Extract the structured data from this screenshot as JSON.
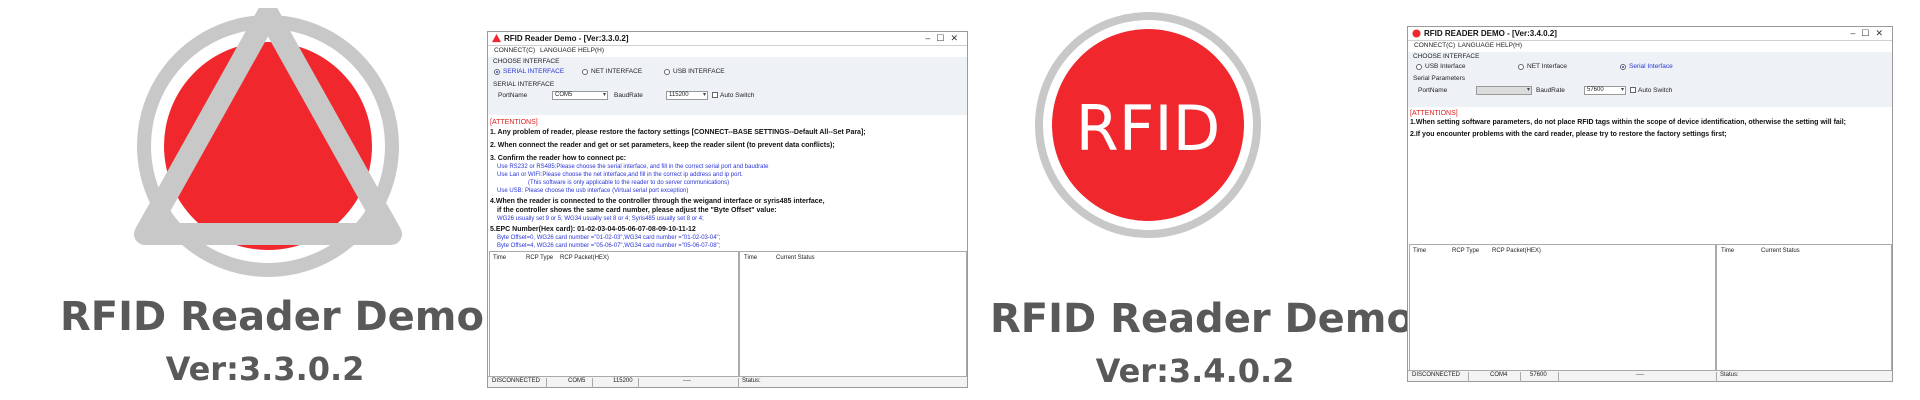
{
  "left_logo": {
    "title": "RFID Reader Demo",
    "version": "Ver:3.3.0.2",
    "colors": {
      "ring": "#c8c8c8",
      "circle": "#f0282d"
    }
  },
  "right_logo": {
    "title": "RFID Reader Demo",
    "version": "Ver:3.4.0.2",
    "circle_text": "RFID",
    "colors": {
      "ring": "#c8c8c8",
      "circle": "#f0282d"
    }
  },
  "win1": {
    "title": "RFID Reader Demo - [Ver:3.3.0.2]",
    "menu": [
      "CONNECT(C)",
      "LANGUAGE",
      "HELP(H)"
    ],
    "choose_interface": "CHOOSE INTERFACE",
    "interfaces": [
      "SERIAL INTERFACE",
      "NET INTERFACE",
      "USB INTERFACE"
    ],
    "selected_interface": "SERIAL INTERFACE",
    "serial_interface": "SERIAL INTERFACE",
    "port_label": "PortName",
    "port_value": "COM5",
    "baud_label": "BaudRate",
    "baud_value": "115200",
    "auto_switch": "Auto Switch",
    "attentions": "[ATTENTIONS]",
    "lines": [
      "1. Any problem of reader, please restore the factory settings [CONNECT--BASE SETTINGS--Default All--Set Para];",
      "2. When connect the reader and get or set parameters, keep the reader silent (to prevent data conflicts);",
      "3. Confirm the reader how to connect pc:",
      "Use RS232 or RS485:Please choose the serial interface, and fill in the correct serial port and baudrate",
      "Use Lan or WIFI:Please choose the net interface,and fill in the correct ip address and ip port.",
      "(This software is only applicable to the reader to do server communications)",
      "Use USB: Please choose the usb interface (Virtual serial port exception)",
      "4.When the reader is connected to the controller through the weigand interface or syris485 interface,",
      "if the controller shows the same card number, please adjust the \"Byte Offset\" value:",
      "WG26 usually set 9 or 5;    WG34 usually set 8 or 4;     Syris485 usually set 8 or 4;",
      "5.EPC Number(Hex card): 01-02-03-04-05-06-07-08-09-10-11-12",
      "Byte Offset=0, WG26 card number =\"01-02-03\",WG34 card number =\"01-02-03-04\";",
      "Byte Offset=4, WG26 card number =\"05-06-07\",WG34 card number =\"05-06-07-08\";"
    ],
    "log_headers": [
      "Time",
      "RCP Type",
      "RCP Packet(HEX)"
    ],
    "status_headers": [
      "Time",
      "Current Status"
    ],
    "status": [
      "DISCONNECTED",
      "COM5",
      "115200",
      "----",
      "Status:"
    ]
  },
  "win2": {
    "title": "RFID READER DEMO - [Ver:3.4.0.2]",
    "menu": [
      "CONNECT(C)",
      "LANGUAGE",
      "HELP(H)"
    ],
    "choose_interface": "CHOOSE INTERFACE",
    "interfaces": [
      "USB Interface",
      "NET Interface",
      "Serial Interface"
    ],
    "selected_interface": "Serial Interface",
    "serial_params": "Serial Parameters",
    "port_label": "PortName",
    "port_value": "",
    "baud_label": "BaudRate",
    "baud_value": "57600",
    "auto_switch": "Auto Switch",
    "attentions": "[ATTENTIONS]",
    "lines": [
      "1.When setting software parameters, do not place RFID tags within the scope of device identification, otherwise the setting will fail;",
      "2.If you encounter problems with the card reader, please try to restore the factory settings first;"
    ],
    "log_headers": [
      "Time",
      "RCP Type",
      "RCP Packet(HEX)"
    ],
    "status_headers": [
      "Time",
      "Current Status"
    ],
    "status": [
      "DISCONNECTED",
      "COM4",
      "57600",
      "----",
      "Status:"
    ]
  }
}
